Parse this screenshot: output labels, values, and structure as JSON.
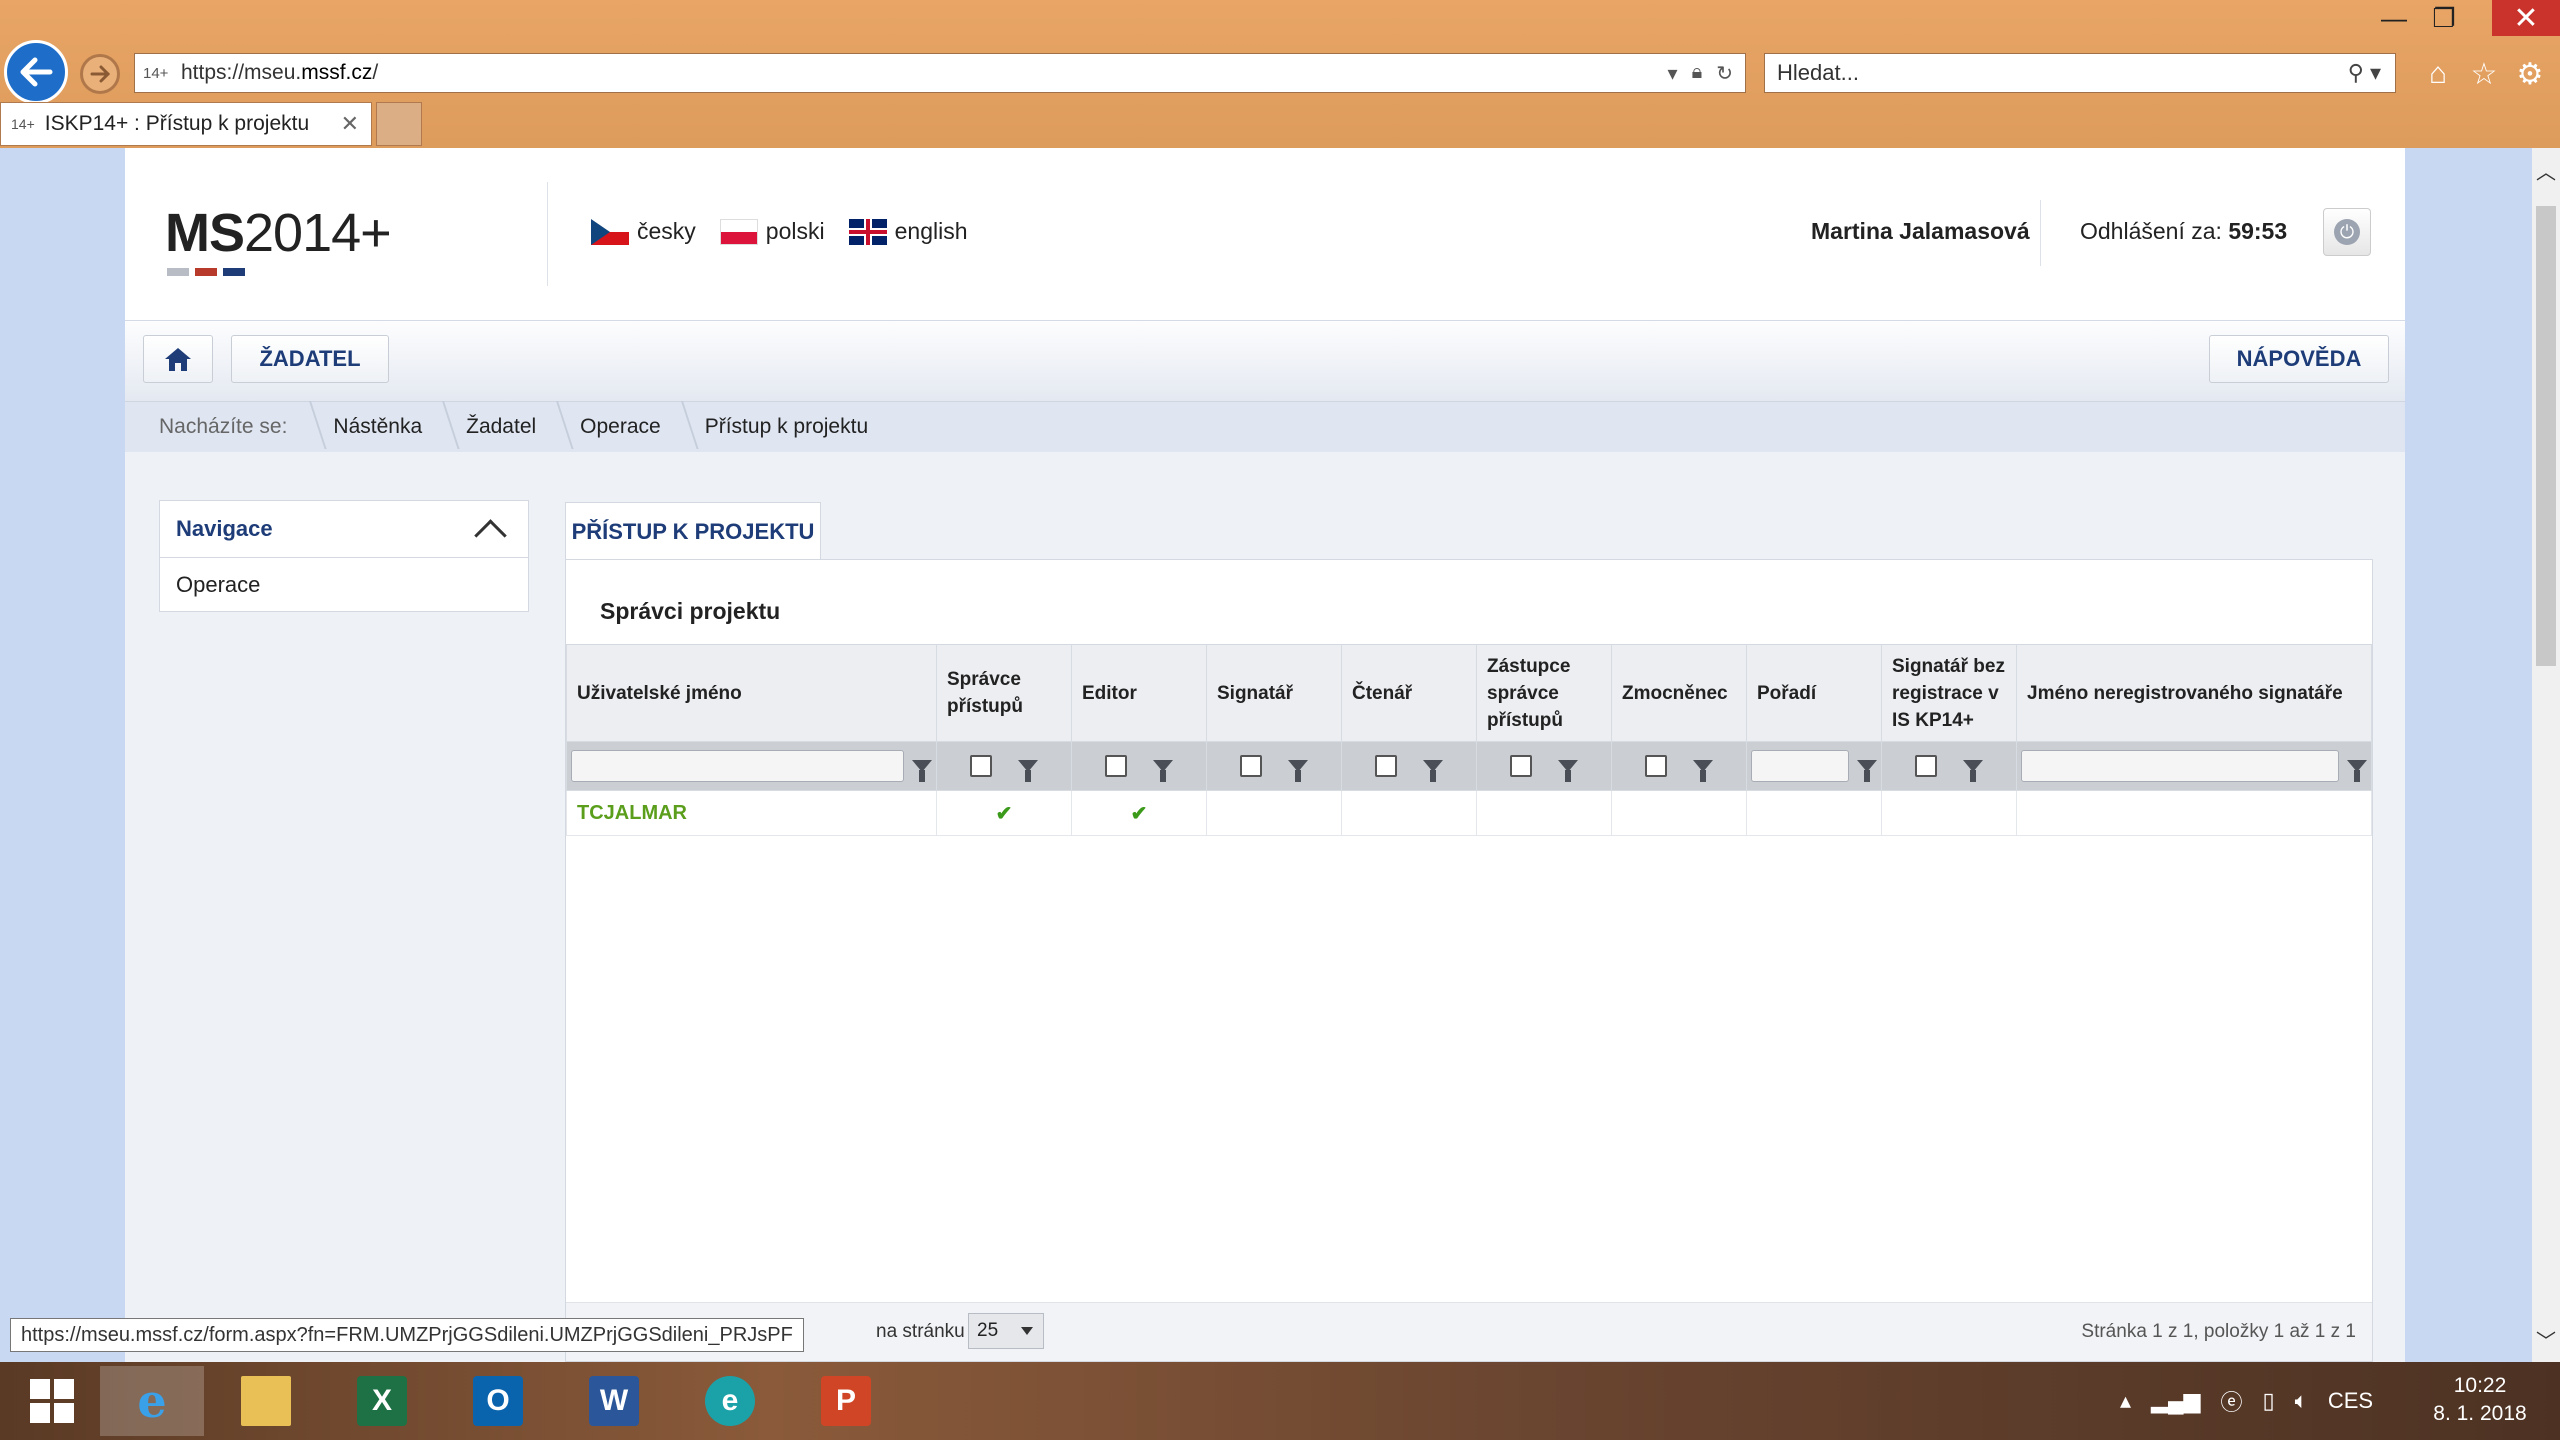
{
  "browser": {
    "url_prefix": "https://mseu.",
    "url_domain": "mssf.cz",
    "url_suffix": "/",
    "favicon": "14+",
    "search_placeholder": "Hledat...",
    "tab_title": "ISKP14+ : Přístup k projektu",
    "status_url": "https://mseu.mssf.cz/form.aspx?fn=FRM.UMZPrjGGSdileni.UMZPrjGGSdileni_PRJsPF"
  },
  "header": {
    "logo_mark": "MS",
    "logo_year": "2014+",
    "languages": [
      "česky",
      "polski",
      "english"
    ],
    "user_name": "Martina Jalamasová",
    "logout_label": "Odhlášení za:",
    "logout_time": "59:53"
  },
  "menu": {
    "zadatel": "ŽADATEL",
    "napoveda": "NÁPOVĚDA"
  },
  "breadcrumb": {
    "label": "Nacházíte se:",
    "items": [
      "Nástěnka",
      "Žadatel",
      "Operace",
      "Přístup k projektu"
    ]
  },
  "navigation": {
    "title": "Navigace",
    "items": [
      "Operace"
    ]
  },
  "main": {
    "tab": "PŘÍSTUP K PROJEKTU",
    "panel_title": "Správci projektu",
    "columns": [
      "Uživatelské jméno",
      "Správce přístupů",
      "Editor",
      "Signatář",
      "Čtenář",
      "Zástupce správce přístupů",
      "Zmocněnec",
      "Pořadí",
      "Signatář bez registrace v IS KP14+",
      "Jméno neregistrovaného signatáře"
    ],
    "rows": [
      {
        "username": "TCJALMAR",
        "spravce_pristupu": true,
        "editor": true,
        "signatar": false,
        "ctenar": false,
        "zastupce": false,
        "zmocnenec": false,
        "poradi": "",
        "signatar_bez_registrace": false,
        "jmeno_neregistrovaneho": ""
      }
    ],
    "pager": {
      "page_size_label": "na stránku",
      "page_size": "25",
      "info": "Stránka 1 z 1, položky 1 až 1 z 1"
    }
  },
  "taskbar": {
    "language": "CES",
    "time": "10:22",
    "date": "8. 1. 2018"
  },
  "colors": {
    "accent": "#1d3c78",
    "link_green": "#5a9e1c",
    "chrome": "#e0a15f"
  }
}
